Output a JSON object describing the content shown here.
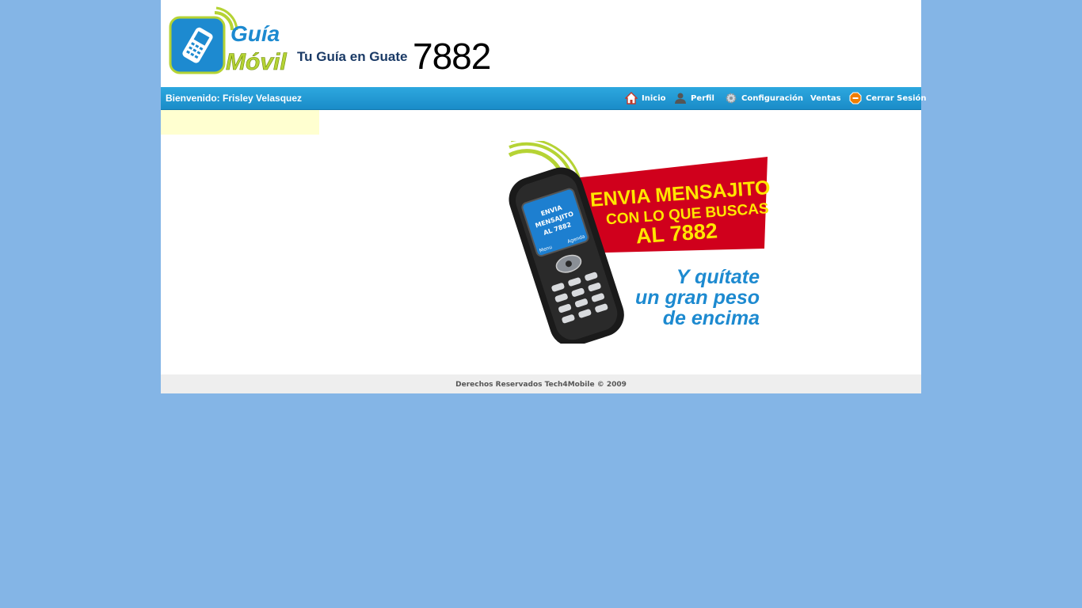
{
  "header": {
    "logo_line1": "Guía",
    "logo_line2": "Móvil",
    "tagline": "Tu Guía en Guate",
    "number": "7882"
  },
  "navbar": {
    "welcome": "Bienvenido: Frisley Velasquez",
    "items": [
      {
        "label": "Inicio",
        "icon": "home-icon"
      },
      {
        "label": "Perfil",
        "icon": "profile-icon"
      },
      {
        "label": "Configuración",
        "icon": "gear-icon"
      },
      {
        "label": "Ventas",
        "icon": ""
      },
      {
        "label": "Cerrar Sesión",
        "icon": "logout-icon"
      }
    ]
  },
  "banner": {
    "red_line1": "ENVIA MENSAJITO",
    "red_line2": "CON LO QUE BUSCAS",
    "red_line3": "AL 7882",
    "blue_line1": "Y quítate",
    "blue_line2": "un gran peso",
    "blue_line3": "de encima",
    "screen_line1": "ENVIA",
    "screen_line2": "MENSAJITO",
    "screen_line3": "AL 7882",
    "screen_menu": "Menu",
    "screen_agenda": "Agenda"
  },
  "footer": {
    "text": "Derechos Reservados Tech4Mobile © 2009"
  },
  "colors": {
    "background": "#84b5e6",
    "nav_blue": "#1a8cc8",
    "brand_green": "#b5d334",
    "brand_blue": "#1d8ad0",
    "banner_red": "#d0001c",
    "banner_yellow": "#ffe600"
  }
}
